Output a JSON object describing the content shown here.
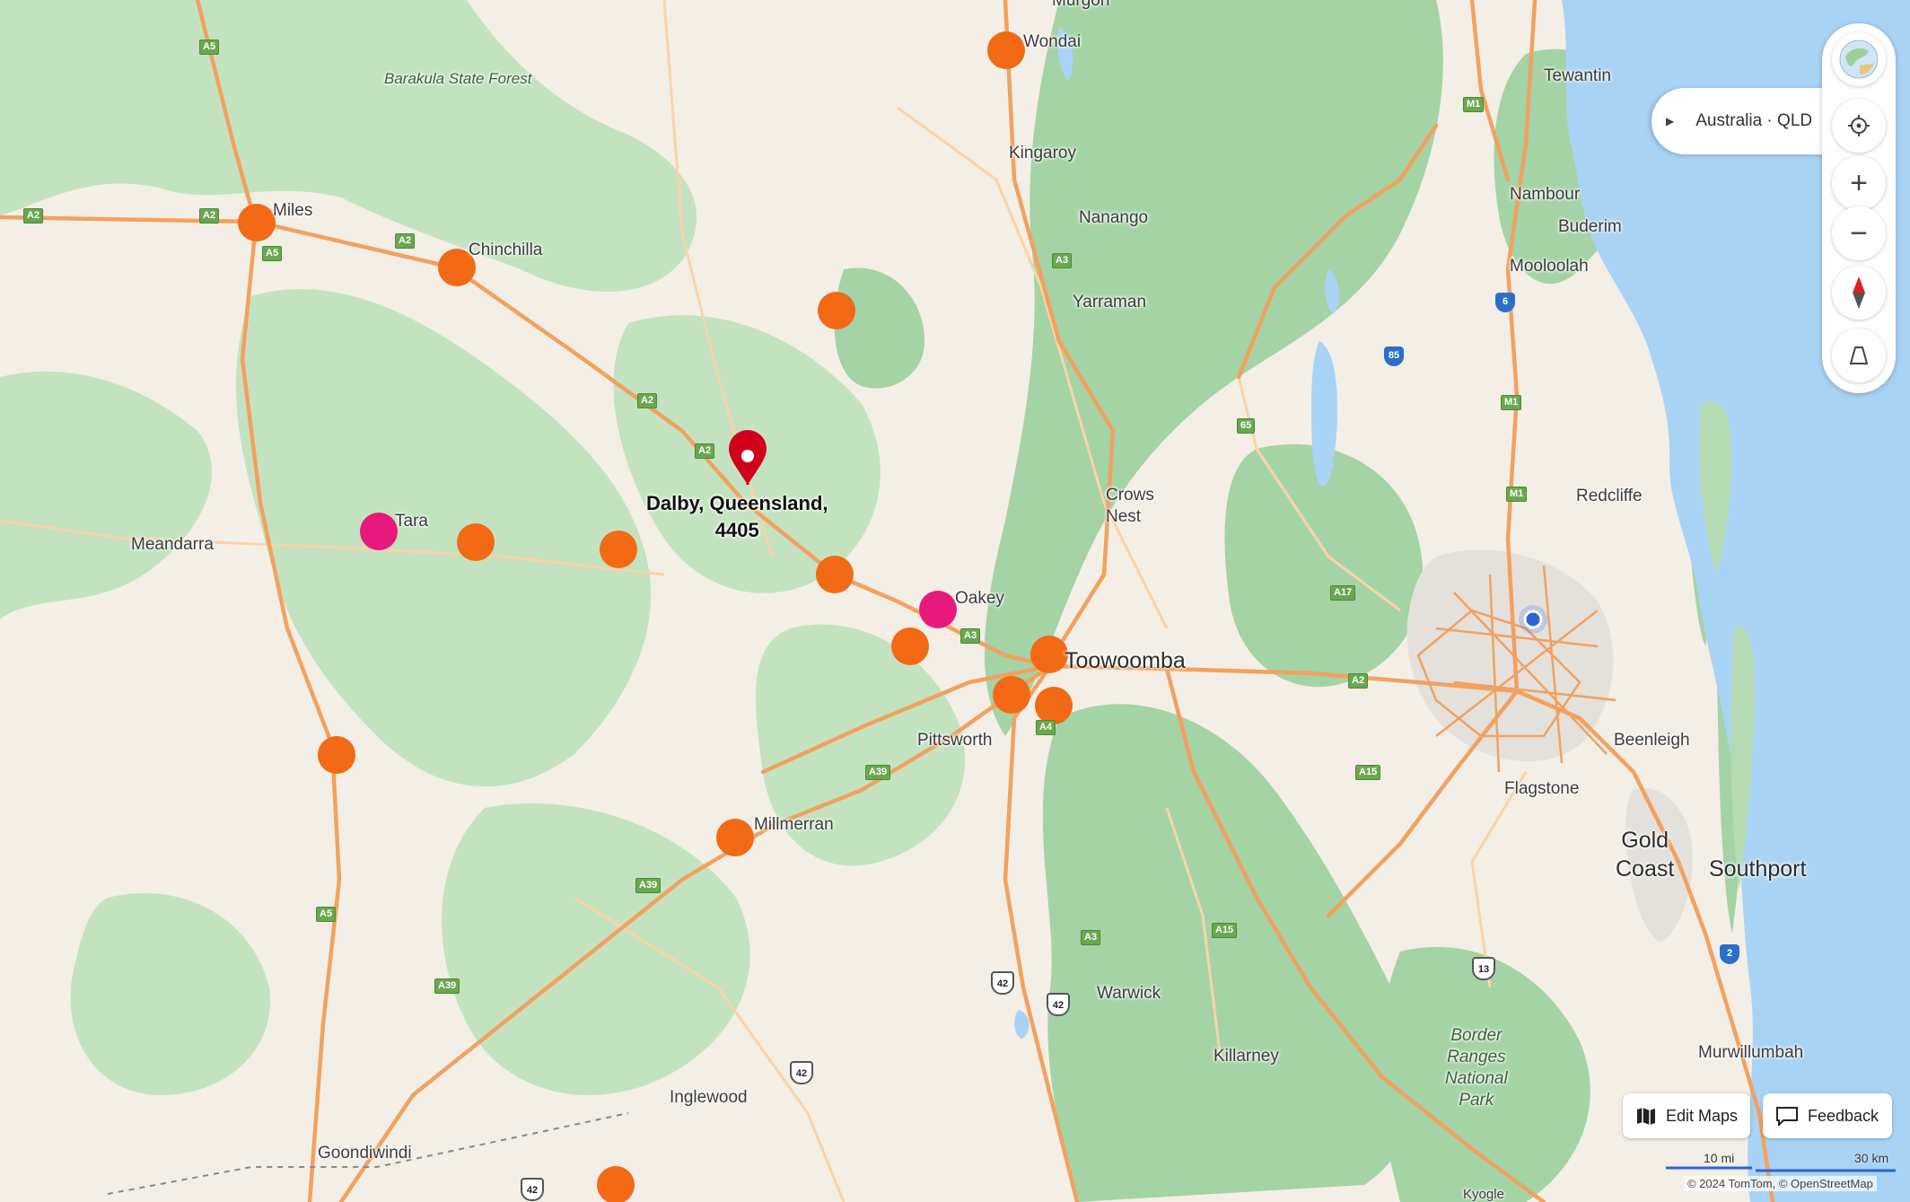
{
  "map": {
    "places": {
      "barakula": "Barakula State Forest",
      "wondai": "Wondai",
      "murgon": "Murgon",
      "kingaroy": "Kingaroy",
      "nanango": "Nanango",
      "yarraman": "Yarraman",
      "miles": "Miles",
      "chinchilla": "Chinchilla",
      "tewantin": "Tewantin",
      "nambour": "Nambour",
      "buderim": "Buderim",
      "mooloolah": "Mooloolah",
      "crows_nest": "Crows\nNest",
      "redcliffe": "Redcliffe",
      "meandarra": "Meandarra",
      "tara": "Tara",
      "oakey": "Oakey",
      "toowoomba": "Toowoomba",
      "pittsworth": "Pittsworth",
      "beenleigh": "Beenleigh",
      "flagstone": "Flagstone",
      "millmerran": "Millmerran",
      "gold_coast": "Gold\nCoast",
      "southport": "Southport",
      "warwick": "Warwick",
      "border_ranges": "Border\nRanges\nNational\nPark",
      "murwillumbah": "Murwillumbah",
      "killarney": "Killarney",
      "inglewood": "Inglewood",
      "goondiwindi": "Goondiwindi",
      "kyogle": "Kyogle"
    },
    "destination": {
      "label": "Dalby, Queensland,\n4405",
      "pin_color": "#d0021b"
    },
    "shields": {
      "a5_top": "A5",
      "a2_left": "A2",
      "a2_miles": "A2",
      "a5_miles": "A5",
      "a2_chin": "A2",
      "a2_mid1": "A2",
      "a2_mid2": "A2",
      "a3_nanango": "A3",
      "m1_a": "M1",
      "m1_b": "M1",
      "m1_c": "M1",
      "r6": "6",
      "r85": "85",
      "r65": "65",
      "a3_oakey": "A3",
      "a17": "A17",
      "a2_east": "A2",
      "a4": "A4",
      "a39_a": "A39",
      "a39_b": "A39",
      "a39_c": "A39",
      "a5_south": "A5",
      "a3_south": "A3",
      "a15_a": "A15",
      "a15_b": "A15",
      "r42_a": "42",
      "r42_b": "42",
      "r42_c": "42",
      "r42_d": "42",
      "r13": "13",
      "r2": "2"
    }
  },
  "controls": {
    "location_text": "Australia · QLD",
    "zoom_in": "+",
    "zoom_out": "−",
    "edit_maps": "Edit Maps",
    "feedback": "Feedback",
    "scale_mi": "10 mi",
    "scale_km": "30 km",
    "copyright": "© 2024 TomTom, © OpenStreetMap"
  },
  "colors": {
    "poi_orange": "#f26a15",
    "poi_pink": "#e8197d",
    "water": "#a9d3f5",
    "forest": "#b4dbb4",
    "dense_forest": "#8fc79a",
    "road": "#f2a15f",
    "my_location": "#2b63d9"
  }
}
